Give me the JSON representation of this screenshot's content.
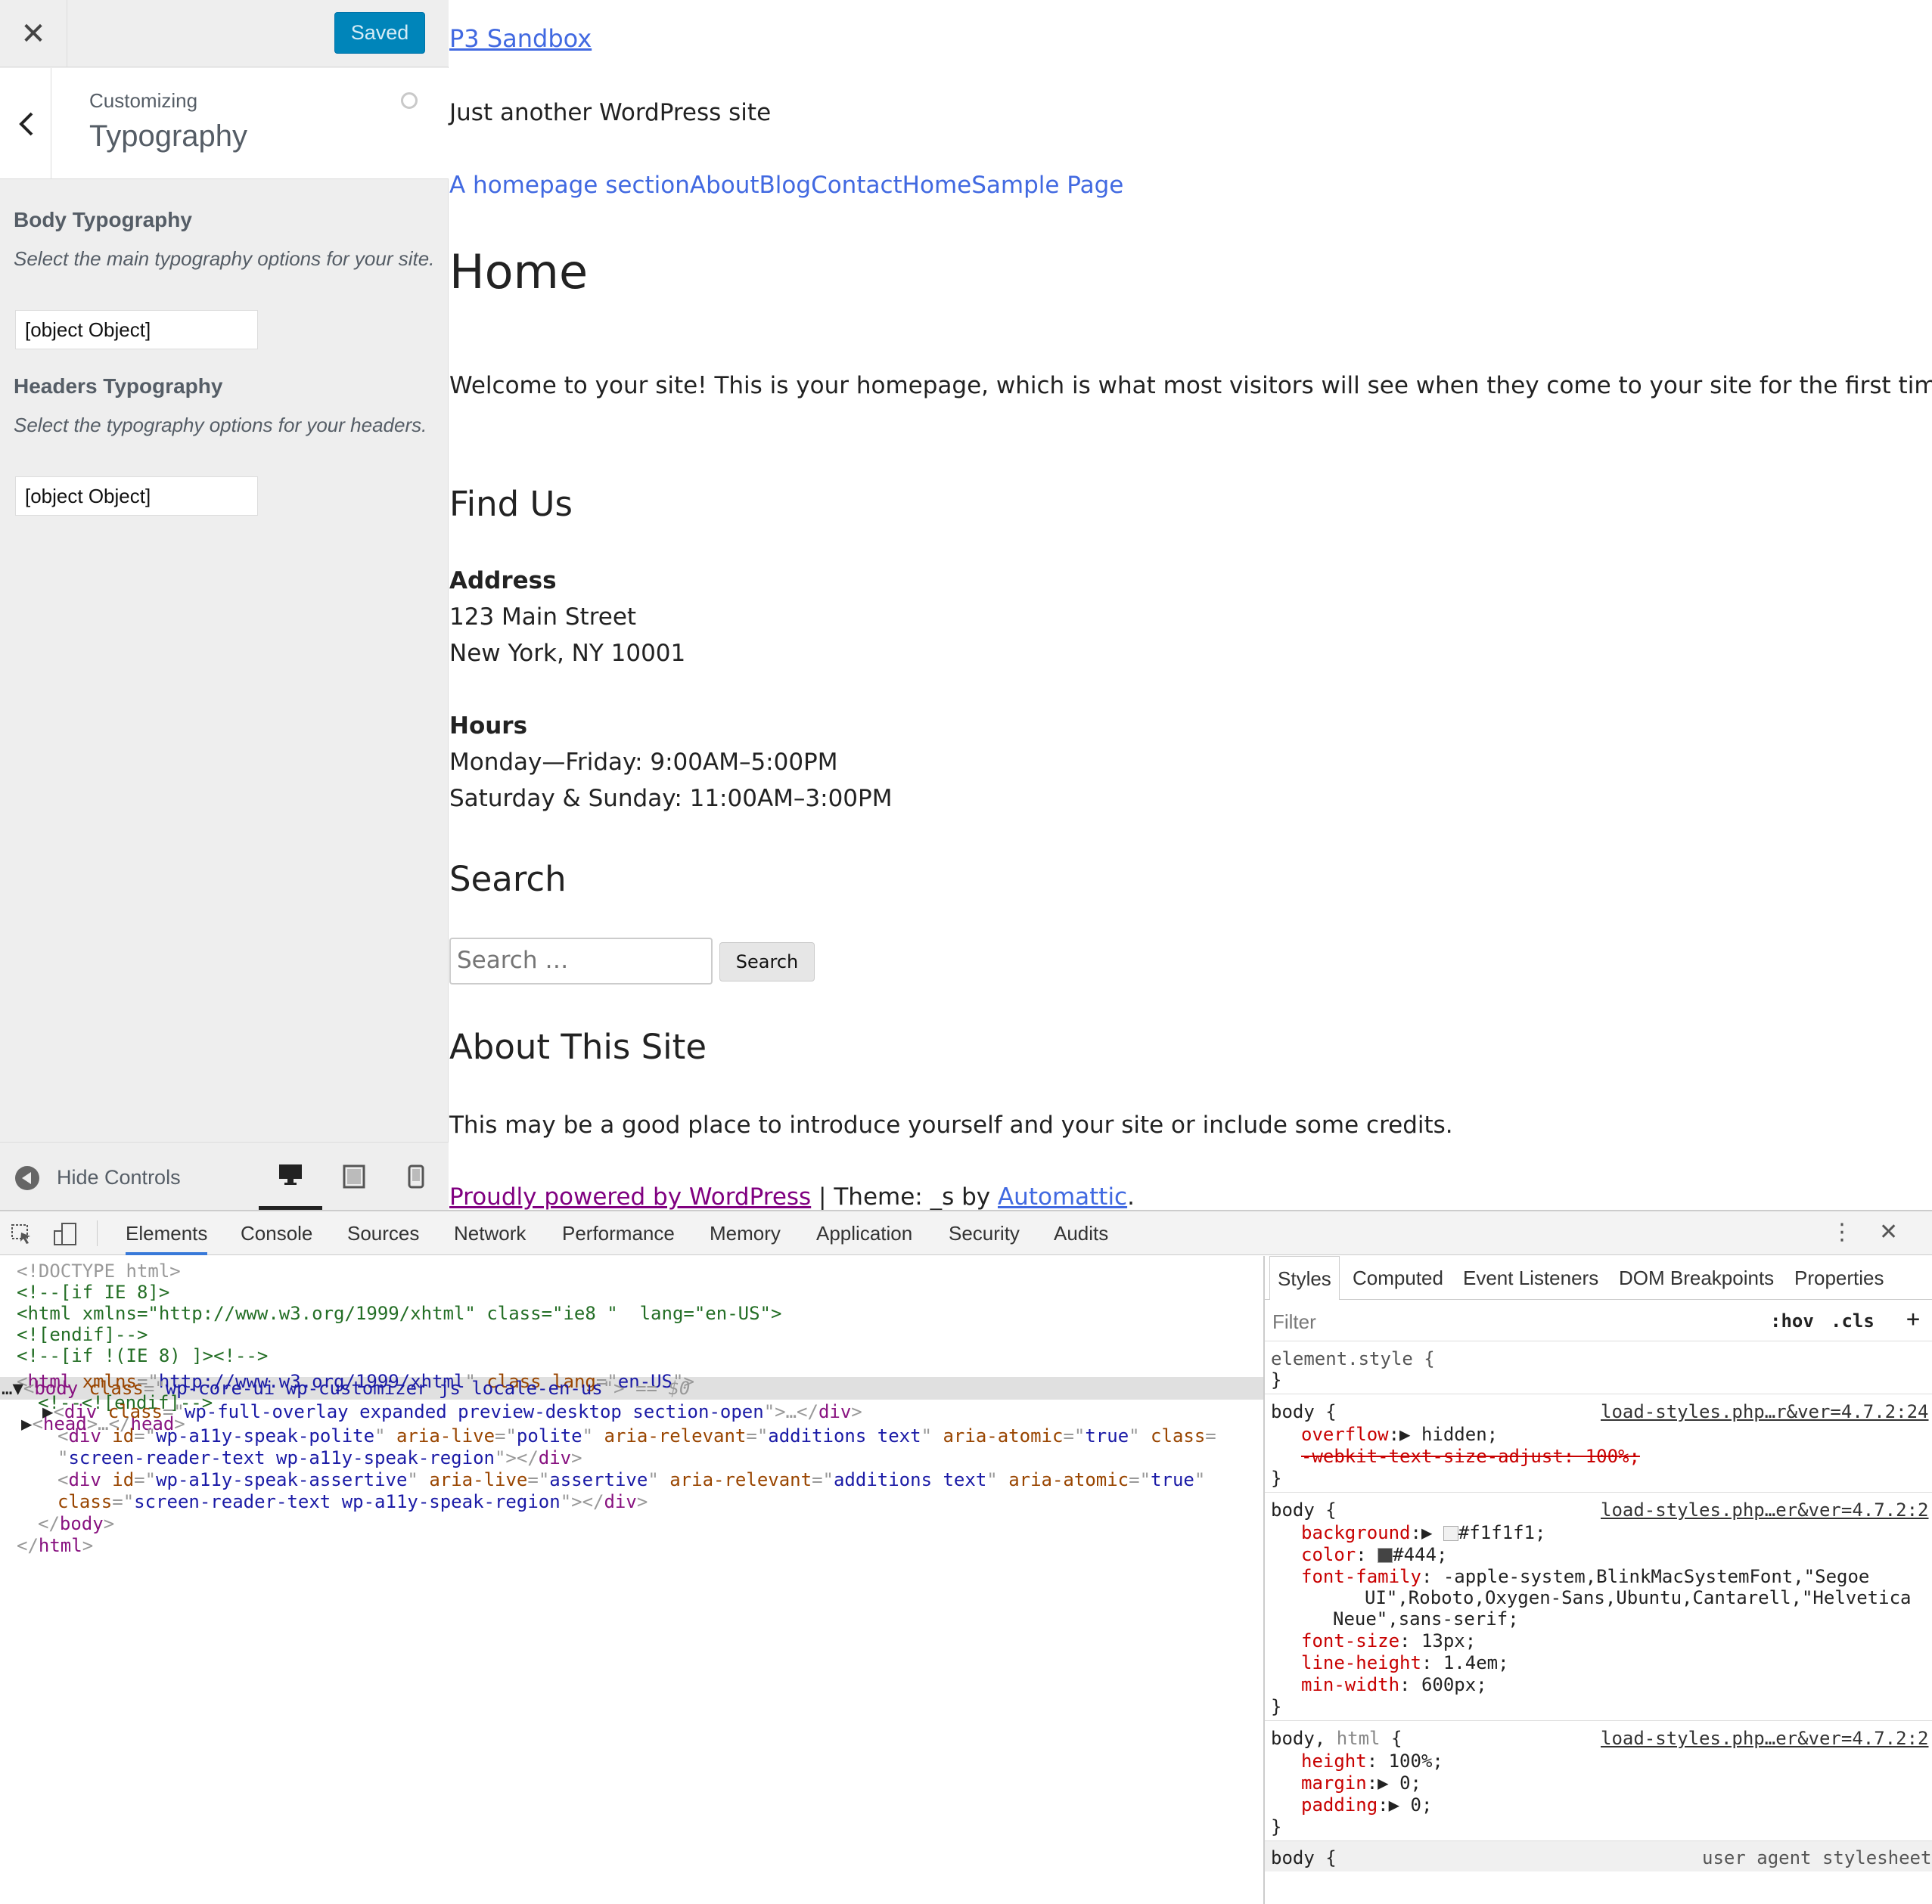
{
  "sidebar": {
    "saved_label": "Saved",
    "customizing_label": "Customizing",
    "section_title": "Typography",
    "sections": [
      {
        "title": "Body Typography",
        "description": "Select the main typography options for your site.",
        "value": "[object Object]"
      },
      {
        "title": "Headers Typography",
        "description": "Select the typography options for your headers.",
        "value": "[object Object]"
      }
    ],
    "hide_controls_label": "Hide Controls"
  },
  "preview": {
    "site_title": "P3 Sandbox",
    "tagline": "Just another WordPress site",
    "nav_items": [
      "A homepage section",
      "About",
      "Blog",
      "Contact",
      "Home",
      "Sample Page"
    ],
    "page_title": "Home",
    "intro": "Welcome to your site! This is your homepage, which is what most visitors will see when they come to your site for the first time.",
    "find_us_title": "Find Us",
    "address_label": "Address",
    "address_line1": "123 Main Street",
    "address_line2": "New York, NY 10001",
    "hours_label": "Hours",
    "hours_line1": "Monday—Friday: 9:00AM–5:00PM",
    "hours_line2": "Saturday & Sunday: 11:00AM–3:00PM",
    "search_title": "Search",
    "search_placeholder": "Search …",
    "search_button": "Search",
    "about_title": "About This Site",
    "about_text": "This may be a good place to introduce yourself and your site or include some credits.",
    "footer_link": "Proudly powered by WordPress",
    "footer_mid": " | Theme: _s by ",
    "footer_author": "Automattic",
    "footer_end": "."
  },
  "devtools": {
    "tabs": [
      "Elements",
      "Console",
      "Sources",
      "Network",
      "Performance",
      "Memory",
      "Application",
      "Security",
      "Audits"
    ],
    "active_tab": "Elements",
    "styles_tabs": [
      "Styles",
      "Computed",
      "Event Listeners",
      "DOM Breakpoints",
      "Properties"
    ],
    "filter_placeholder": "Filter",
    "hov": ":hov",
    "cls": ".cls",
    "colors": {
      "accent": "#3879d9",
      "tag": "#881280",
      "attr_name": "#994500",
      "attr_value": "#1a1aa6",
      "comment": "#236e25",
      "prop_name": "#c80000"
    },
    "dom": {
      "doctype": "<!DOCTYPE html>",
      "c1": "<!--[if IE 8]>",
      "c2": "<html xmlns=\"http://www.w3.org/1999/xhtml\" class=\"ie8 \"  lang=\"en-US\">",
      "c3": "<![endif]-->",
      "c4": "<!--[if !(IE 8) ]><!-->",
      "html_tag": "html",
      "html_xmlns_name": "xmlns",
      "html_xmlns": "http://www.w3.org/1999/xhtml",
      "html_class_name": "class",
      "html_lang_name": "lang",
      "html_lang": "en-US",
      "c5": "<!--<![endif]-->",
      "head": "head",
      "body_tag": "body",
      "body_class": "wp-core-ui wp-customizer js locale-en-us",
      "eq": "== $0",
      "div1_class": "wp-full-overlay expanded preview-desktop section-open",
      "div2_id": "wp-a11y-speak-polite",
      "div2_live": "polite",
      "relevant": "additions text",
      "atomic": "true",
      "sr_class": "screen-reader-text wp-a11y-speak-region",
      "div3_id": "wp-a11y-speak-assertive",
      "div3_live": "assertive"
    },
    "styles": {
      "element_style": "element.style {",
      "rule1_src": "load-styles.php…r&ver=4.7.2:24",
      "rule2_src": "load-styles.php…er&ver=4.7.2:2",
      "rule3_src": "load-styles.php…er&ver=4.7.2:2",
      "ua": "user agent stylesheet",
      "overflow": "hidden;",
      "webkit": "-webkit-text-size-adjust: 100%;",
      "background": "#f1f1f1;",
      "color": "#444;",
      "font_family_1": "-apple-system,BlinkMacSystemFont,\"Segoe",
      "font_family_2": "UI\",Roboto,Oxygen-Sans,Ubuntu,Cantarell,\"Helvetica",
      "font_family_3": "Neue\",sans-serif;",
      "font_size": "13px;",
      "line_height": "1.4em;",
      "min_width": "600px;",
      "height": "100%;",
      "margin": "0;",
      "padding": "0;",
      "swatch_bg": "#f1f1f1",
      "swatch_color": "#444444"
    }
  }
}
